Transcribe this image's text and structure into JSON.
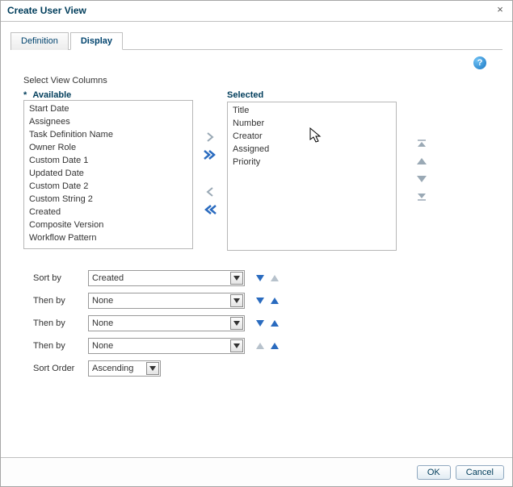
{
  "dialog": {
    "title": "Create User View"
  },
  "tabs": {
    "definition": "Definition",
    "display": "Display"
  },
  "section_label": "Select View Columns",
  "available_header": "Available",
  "selected_header": "Selected",
  "available_items": [
    "Start Date",
    "Assignees",
    "Task Definition Name",
    "Owner Role",
    "Custom Date 1",
    "Updated Date",
    "Custom Date 2",
    "Custom String 2",
    "Created",
    "Composite Version",
    "Workflow Pattern"
  ],
  "selected_items": [
    "Title",
    "Number",
    "Creator",
    "Assigned",
    "Priority"
  ],
  "sort": {
    "labels": {
      "sortby": "Sort by",
      "thenby": "Then by",
      "order": "Sort Order"
    },
    "row1": "Created",
    "row2": "None",
    "row3": "None",
    "row4": "None",
    "order": "Ascending"
  },
  "buttons": {
    "ok": "OK",
    "cancel": "Cancel"
  }
}
